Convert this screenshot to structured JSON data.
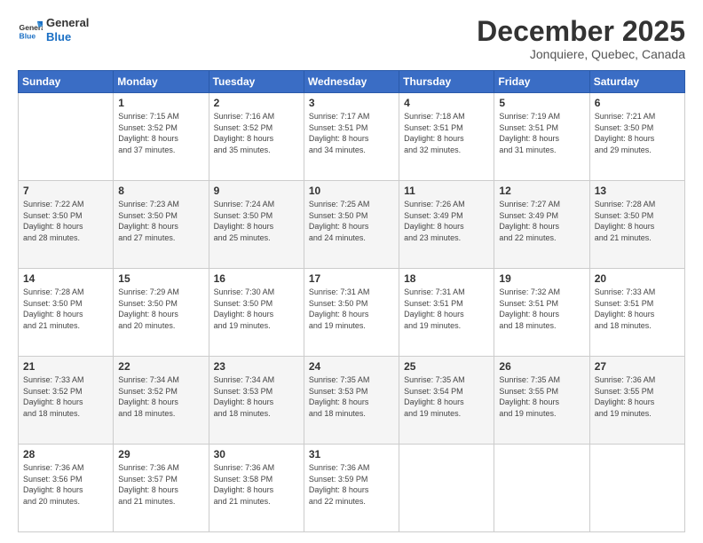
{
  "header": {
    "logo_line1": "General",
    "logo_line2": "Blue",
    "month": "December 2025",
    "location": "Jonquiere, Quebec, Canada"
  },
  "weekdays": [
    "Sunday",
    "Monday",
    "Tuesday",
    "Wednesday",
    "Thursday",
    "Friday",
    "Saturday"
  ],
  "weeks": [
    [
      {
        "day": "",
        "info": ""
      },
      {
        "day": "1",
        "info": "Sunrise: 7:15 AM\nSunset: 3:52 PM\nDaylight: 8 hours\nand 37 minutes."
      },
      {
        "day": "2",
        "info": "Sunrise: 7:16 AM\nSunset: 3:52 PM\nDaylight: 8 hours\nand 35 minutes."
      },
      {
        "day": "3",
        "info": "Sunrise: 7:17 AM\nSunset: 3:51 PM\nDaylight: 8 hours\nand 34 minutes."
      },
      {
        "day": "4",
        "info": "Sunrise: 7:18 AM\nSunset: 3:51 PM\nDaylight: 8 hours\nand 32 minutes."
      },
      {
        "day": "5",
        "info": "Sunrise: 7:19 AM\nSunset: 3:51 PM\nDaylight: 8 hours\nand 31 minutes."
      },
      {
        "day": "6",
        "info": "Sunrise: 7:21 AM\nSunset: 3:50 PM\nDaylight: 8 hours\nand 29 minutes."
      }
    ],
    [
      {
        "day": "7",
        "info": "Sunrise: 7:22 AM\nSunset: 3:50 PM\nDaylight: 8 hours\nand 28 minutes."
      },
      {
        "day": "8",
        "info": "Sunrise: 7:23 AM\nSunset: 3:50 PM\nDaylight: 8 hours\nand 27 minutes."
      },
      {
        "day": "9",
        "info": "Sunrise: 7:24 AM\nSunset: 3:50 PM\nDaylight: 8 hours\nand 25 minutes."
      },
      {
        "day": "10",
        "info": "Sunrise: 7:25 AM\nSunset: 3:50 PM\nDaylight: 8 hours\nand 24 minutes."
      },
      {
        "day": "11",
        "info": "Sunrise: 7:26 AM\nSunset: 3:49 PM\nDaylight: 8 hours\nand 23 minutes."
      },
      {
        "day": "12",
        "info": "Sunrise: 7:27 AM\nSunset: 3:49 PM\nDaylight: 8 hours\nand 22 minutes."
      },
      {
        "day": "13",
        "info": "Sunrise: 7:28 AM\nSunset: 3:50 PM\nDaylight: 8 hours\nand 21 minutes."
      }
    ],
    [
      {
        "day": "14",
        "info": "Sunrise: 7:28 AM\nSunset: 3:50 PM\nDaylight: 8 hours\nand 21 minutes."
      },
      {
        "day": "15",
        "info": "Sunrise: 7:29 AM\nSunset: 3:50 PM\nDaylight: 8 hours\nand 20 minutes."
      },
      {
        "day": "16",
        "info": "Sunrise: 7:30 AM\nSunset: 3:50 PM\nDaylight: 8 hours\nand 19 minutes."
      },
      {
        "day": "17",
        "info": "Sunrise: 7:31 AM\nSunset: 3:50 PM\nDaylight: 8 hours\nand 19 minutes."
      },
      {
        "day": "18",
        "info": "Sunrise: 7:31 AM\nSunset: 3:51 PM\nDaylight: 8 hours\nand 19 minutes."
      },
      {
        "day": "19",
        "info": "Sunrise: 7:32 AM\nSunset: 3:51 PM\nDaylight: 8 hours\nand 18 minutes."
      },
      {
        "day": "20",
        "info": "Sunrise: 7:33 AM\nSunset: 3:51 PM\nDaylight: 8 hours\nand 18 minutes."
      }
    ],
    [
      {
        "day": "21",
        "info": "Sunrise: 7:33 AM\nSunset: 3:52 PM\nDaylight: 8 hours\nand 18 minutes."
      },
      {
        "day": "22",
        "info": "Sunrise: 7:34 AM\nSunset: 3:52 PM\nDaylight: 8 hours\nand 18 minutes."
      },
      {
        "day": "23",
        "info": "Sunrise: 7:34 AM\nSunset: 3:53 PM\nDaylight: 8 hours\nand 18 minutes."
      },
      {
        "day": "24",
        "info": "Sunrise: 7:35 AM\nSunset: 3:53 PM\nDaylight: 8 hours\nand 18 minutes."
      },
      {
        "day": "25",
        "info": "Sunrise: 7:35 AM\nSunset: 3:54 PM\nDaylight: 8 hours\nand 19 minutes."
      },
      {
        "day": "26",
        "info": "Sunrise: 7:35 AM\nSunset: 3:55 PM\nDaylight: 8 hours\nand 19 minutes."
      },
      {
        "day": "27",
        "info": "Sunrise: 7:36 AM\nSunset: 3:55 PM\nDaylight: 8 hours\nand 19 minutes."
      }
    ],
    [
      {
        "day": "28",
        "info": "Sunrise: 7:36 AM\nSunset: 3:56 PM\nDaylight: 8 hours\nand 20 minutes."
      },
      {
        "day": "29",
        "info": "Sunrise: 7:36 AM\nSunset: 3:57 PM\nDaylight: 8 hours\nand 21 minutes."
      },
      {
        "day": "30",
        "info": "Sunrise: 7:36 AM\nSunset: 3:58 PM\nDaylight: 8 hours\nand 21 minutes."
      },
      {
        "day": "31",
        "info": "Sunrise: 7:36 AM\nSunset: 3:59 PM\nDaylight: 8 hours\nand 22 minutes."
      },
      {
        "day": "",
        "info": ""
      },
      {
        "day": "",
        "info": ""
      },
      {
        "day": "",
        "info": ""
      }
    ]
  ]
}
